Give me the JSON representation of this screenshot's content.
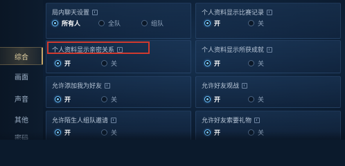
{
  "sidebar": {
    "items": [
      {
        "label": "综合",
        "active": true
      },
      {
        "label": "画面",
        "active": false
      },
      {
        "label": "声音",
        "active": false
      },
      {
        "label": "其他",
        "active": false
      },
      {
        "label": "密码",
        "active": false
      }
    ]
  },
  "settings": {
    "chat": {
      "title": "局内聊天设置",
      "options": [
        {
          "label": "所有人",
          "selected": true
        },
        {
          "label": "全队",
          "selected": false
        },
        {
          "label": "组队",
          "selected": false
        }
      ]
    },
    "show_match_record": {
      "title": "个人资料显示比赛记录",
      "options": [
        {
          "label": "开",
          "selected": true
        },
        {
          "label": "关",
          "selected": false
        }
      ]
    },
    "show_intimacy": {
      "title": "个人资料显示亲密关系",
      "options": [
        {
          "label": "开",
          "selected": true
        },
        {
          "label": "关",
          "selected": false
        }
      ]
    },
    "show_achievements": {
      "title": "个人资料显示所获成就",
      "options": [
        {
          "label": "开",
          "selected": true
        },
        {
          "label": "关",
          "selected": false
        }
      ]
    },
    "allow_add_friend": {
      "title": "允许添加我为好友",
      "options": [
        {
          "label": "开",
          "selected": true
        },
        {
          "label": "关",
          "selected": false
        }
      ]
    },
    "allow_friend_watch": {
      "title": "允许好友观战",
      "options": [
        {
          "label": "开",
          "selected": true
        },
        {
          "label": "关",
          "selected": false
        }
      ]
    },
    "allow_stranger_invite": {
      "title": "允许陌生人组队邀请",
      "options": [
        {
          "label": "开",
          "selected": true
        },
        {
          "label": "关",
          "selected": false
        }
      ]
    },
    "allow_friend_gift": {
      "title": "允许好友索要礼物",
      "options": [
        {
          "label": "开",
          "selected": true
        },
        {
          "label": "关",
          "selected": false
        }
      ]
    }
  },
  "colors": {
    "highlight": "#d23a2e",
    "accent": "#6cc4ff",
    "nav_active": "#e8d6a6"
  }
}
